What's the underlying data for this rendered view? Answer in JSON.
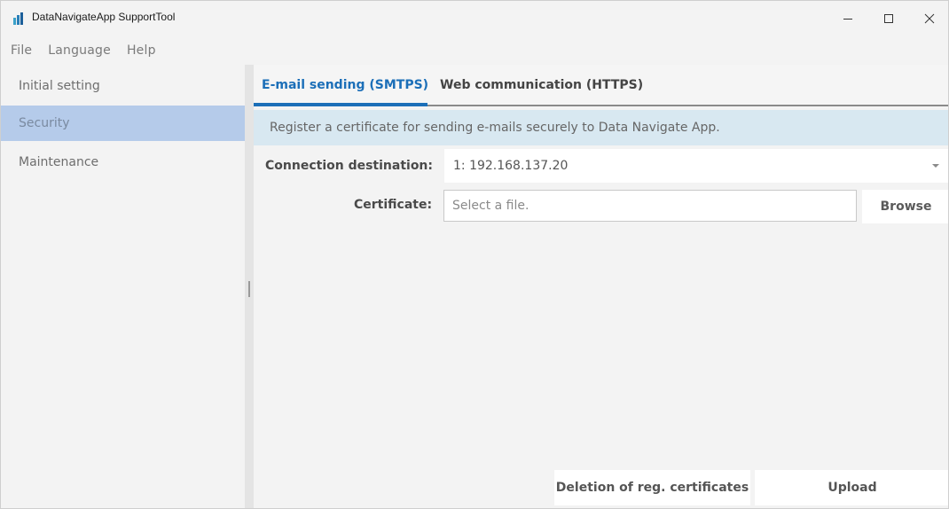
{
  "window": {
    "title": "DataNavigateApp SupportTool",
    "minimize_glyph": "—",
    "maximize_glyph": "☐",
    "close_glyph": "✕"
  },
  "menu": {
    "items": [
      "File",
      "Language",
      "Help"
    ]
  },
  "sidebar": {
    "items": [
      {
        "label": "Initial setting",
        "active": false
      },
      {
        "label": "Security",
        "active": true
      },
      {
        "label": "Maintenance",
        "active": false
      }
    ]
  },
  "tabs": [
    {
      "label": "E-mail sending (SMTPS)",
      "active": true
    },
    {
      "label": "Web communication (HTTPS)",
      "active": false
    }
  ],
  "info_banner": "Register a certificate for sending e-mails securely to Data Navigate App.",
  "form": {
    "connection_label": "Connection destination:",
    "connection_value": "1: 192.168.137.20",
    "certificate_label": "Certificate:",
    "certificate_placeholder": "Select a file.",
    "certificate_value": "",
    "browse_label": "Browse"
  },
  "actions": {
    "delete_label": "Deletion of reg. certificates",
    "upload_label": "Upload"
  },
  "colors": {
    "accent": "#1c6fb8",
    "sidebar_active": "#b5cbea",
    "info_banner_bg": "#d8e8f1"
  },
  "icons": {
    "app": "app-bar-chart-icon",
    "minimize": "minimize-icon",
    "maximize": "maximize-icon",
    "close": "close-icon",
    "dropdown": "chevron-down-icon"
  }
}
